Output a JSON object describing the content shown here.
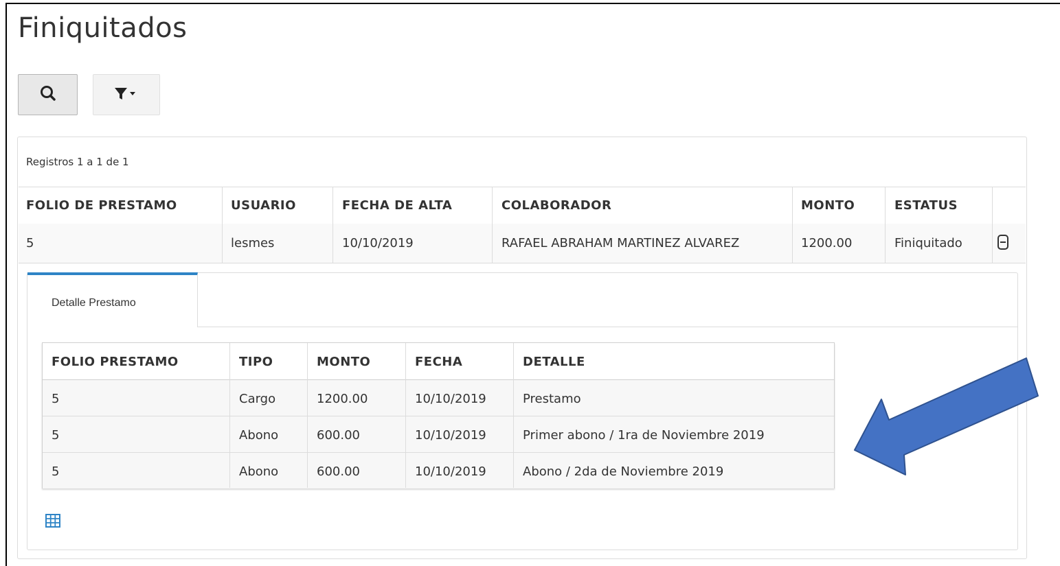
{
  "page": {
    "title": "Finiquitados"
  },
  "toolbar": {
    "search_icon": "search-icon",
    "filter_icon": "filter-dropdown-icon"
  },
  "grid": {
    "records_text": "Registros 1 a 1 de 1",
    "columns": [
      "FOLIO DE PRESTAMO",
      "USUARIO",
      "FECHA DE ALTA",
      "COLABORADOR",
      "MONTO",
      "ESTATUS"
    ],
    "rows": [
      [
        "5",
        "lesmes",
        "10/10/2019",
        "RAFAEL ABRAHAM MARTINEZ ALVAREZ",
        "1200.00",
        "Finiquitado"
      ]
    ]
  },
  "detail": {
    "tab_label": "Detalle Prestamo",
    "columns": [
      "FOLIO PRESTAMO",
      "TIPO",
      "MONTO",
      "FECHA",
      "DETALLE"
    ],
    "rows": [
      [
        "5",
        "Cargo",
        "1200.00",
        "10/10/2019",
        "Prestamo"
      ],
      [
        "5",
        "Abono",
        "600.00",
        "10/10/2019",
        "Primer abono / 1ra de Noviembre 2019"
      ],
      [
        "5",
        "Abono",
        "600.00",
        "10/10/2019",
        "Abono / 2da de Noviembre 2019"
      ]
    ]
  },
  "colors": {
    "accent": "#2e84c6",
    "arrow": "#4472c4",
    "arrow_border": "#2f528f"
  }
}
